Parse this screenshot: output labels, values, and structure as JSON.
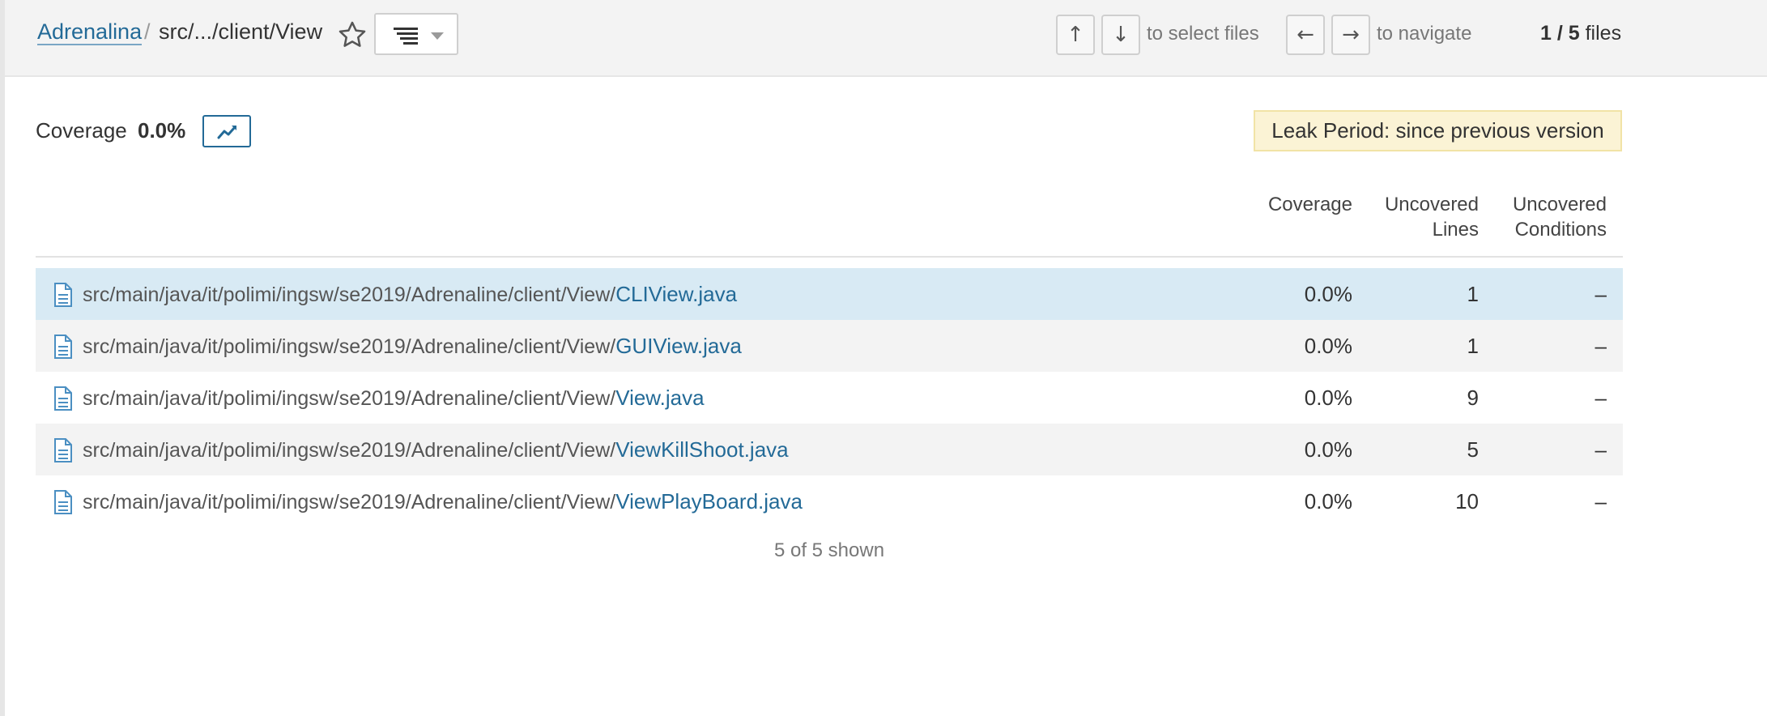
{
  "breadcrumb": {
    "root": "Adrenalina",
    "separator": "/",
    "current": "src/.../client/View"
  },
  "toolbar": {
    "key_up": "↑",
    "key_down": "↓",
    "select_hint": "to select files",
    "key_left": "←",
    "key_right": "→",
    "navigate_hint": "to navigate",
    "files_position": "1 / 5",
    "files_label": "files"
  },
  "summary": {
    "label": "Coverage",
    "value": "0.0%",
    "leak_period": "Leak Period: since previous version"
  },
  "table": {
    "headers": {
      "coverage": "Coverage",
      "uncovered_lines": "Uncovered Lines",
      "uncovered_conditions": "Uncovered Conditions"
    },
    "rows": [
      {
        "dir": "src/main/java/it/polimi/ingsw/se2019/Adrenaline/client/View/",
        "file": "CLIView.java",
        "coverage": "0.0%",
        "lines": "1",
        "conditions": "–"
      },
      {
        "dir": "src/main/java/it/polimi/ingsw/se2019/Adrenaline/client/View/",
        "file": "GUIView.java",
        "coverage": "0.0%",
        "lines": "1",
        "conditions": "–"
      },
      {
        "dir": "src/main/java/it/polimi/ingsw/se2019/Adrenaline/client/View/",
        "file": "View.java",
        "coverage": "0.0%",
        "lines": "9",
        "conditions": "–"
      },
      {
        "dir": "src/main/java/it/polimi/ingsw/se2019/Adrenaline/client/View/",
        "file": "ViewKillShoot.java",
        "coverage": "0.0%",
        "lines": "5",
        "conditions": "–"
      },
      {
        "dir": "src/main/java/it/polimi/ingsw/se2019/Adrenaline/client/View/",
        "file": "ViewPlayBoard.java",
        "coverage": "0.0%",
        "lines": "10",
        "conditions": "–"
      }
    ],
    "shown": "5 of 5 shown"
  },
  "icons": {
    "star": "star-icon",
    "view": "list-view-icon",
    "trend": "trend-chart-icon",
    "file": "file-icon"
  },
  "colors": {
    "link": "#236a97",
    "selected_row": "#d8eaf4",
    "leak_bg": "#fbf3d5"
  }
}
